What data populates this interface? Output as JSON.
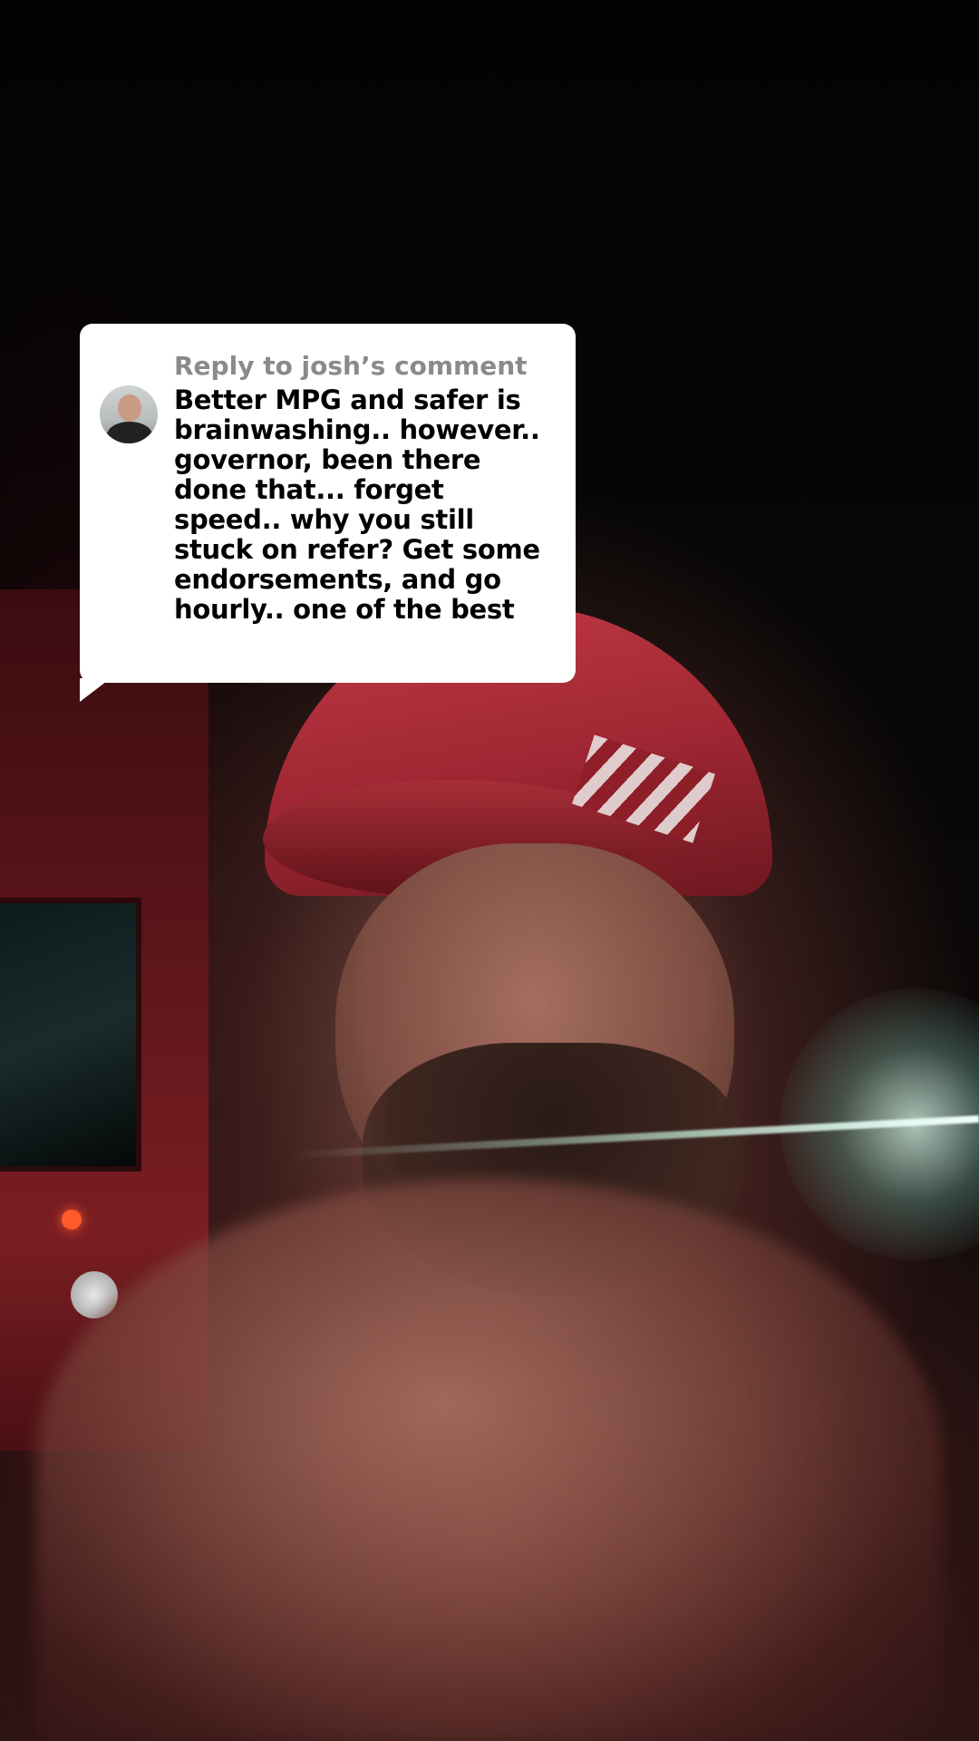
{
  "reply_bubble": {
    "header": "Reply to josh’s comment",
    "avatar_icon": "user-avatar",
    "lines": [
      "Better MPG and safer is",
      "brainwashing.. however..",
      "governor, been there",
      "done that... forget",
      "speed.. why you still",
      "stuck on refer? Get some",
      "endorsements, and go",
      "hourly.. one of the best"
    ]
  }
}
